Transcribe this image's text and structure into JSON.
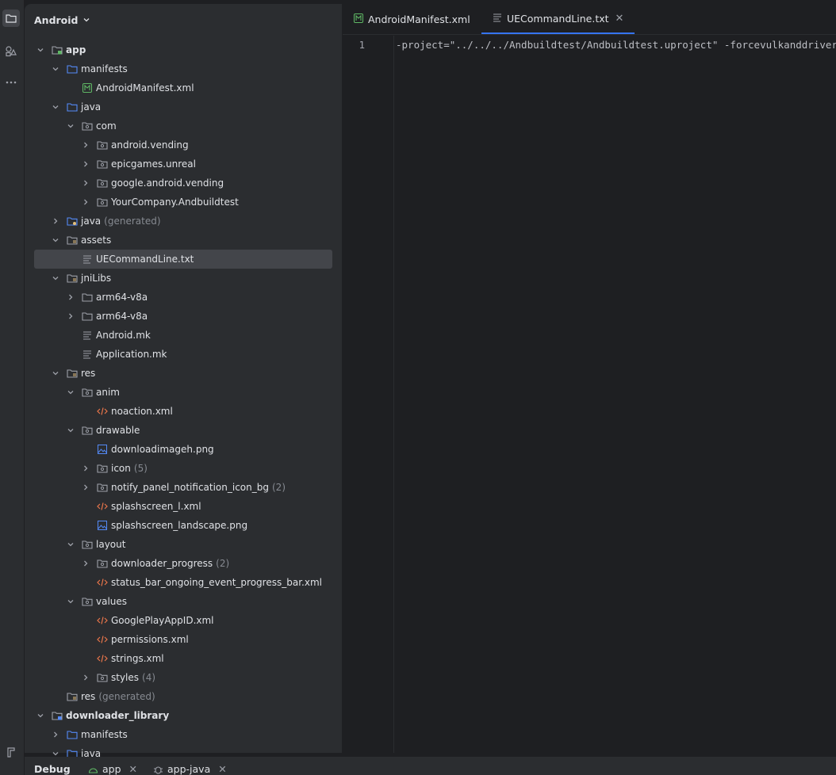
{
  "project_panel": {
    "view_selector": "Android",
    "tree": [
      {
        "label": "app",
        "level": 0,
        "chevron": "down",
        "icon": "module",
        "bold": true
      },
      {
        "label": "manifests",
        "level": 1,
        "chevron": "down",
        "icon": "folder-blue"
      },
      {
        "label": "AndroidManifest.xml",
        "level": 2,
        "chevron": "none",
        "icon": "manifest"
      },
      {
        "label": "java",
        "level": 1,
        "chevron": "down",
        "icon": "folder-blue"
      },
      {
        "label": "com",
        "level": 2,
        "chevron": "down",
        "icon": "package"
      },
      {
        "label": "android.vending",
        "level": 3,
        "chevron": "right",
        "icon": "package"
      },
      {
        "label": "epicgames.unreal",
        "level": 3,
        "chevron": "right",
        "icon": "package"
      },
      {
        "label": "google.android.vending",
        "level": 3,
        "chevron": "right",
        "icon": "package"
      },
      {
        "label": "YourCompany.Andbuildtest",
        "level": 3,
        "chevron": "right",
        "icon": "package"
      },
      {
        "label": "java",
        "level": 1,
        "chevron": "right",
        "icon": "folder-generated",
        "extra": "(generated)"
      },
      {
        "label": "assets",
        "level": 1,
        "chevron": "down",
        "icon": "folder-res"
      },
      {
        "label": "UECommandLine.txt",
        "level": 2,
        "chevron": "none",
        "icon": "text-file",
        "selected": true
      },
      {
        "label": "jniLibs",
        "level": 1,
        "chevron": "down",
        "icon": "folder-res"
      },
      {
        "label": "arm64-v8a",
        "level": 2,
        "chevron": "right",
        "icon": "folder-plain"
      },
      {
        "label": "arm64-v8a",
        "level": 2,
        "chevron": "right",
        "icon": "folder-plain"
      },
      {
        "label": "Android.mk",
        "level": 2,
        "chevron": "none",
        "icon": "text-file"
      },
      {
        "label": "Application.mk",
        "level": 2,
        "chevron": "none",
        "icon": "text-file"
      },
      {
        "label": "res",
        "level": 1,
        "chevron": "down",
        "icon": "folder-res"
      },
      {
        "label": "anim",
        "level": 2,
        "chevron": "down",
        "icon": "package"
      },
      {
        "label": "noaction.xml",
        "level": 3,
        "chevron": "none",
        "icon": "xml-file"
      },
      {
        "label": "drawable",
        "level": 2,
        "chevron": "down",
        "icon": "package"
      },
      {
        "label": "downloadimageh.png",
        "level": 3,
        "chevron": "none",
        "icon": "image-file"
      },
      {
        "label": "icon",
        "level": 3,
        "chevron": "right",
        "icon": "package",
        "extra": "(5)"
      },
      {
        "label": "notify_panel_notification_icon_bg",
        "level": 3,
        "chevron": "right",
        "icon": "package",
        "extra": "(2)"
      },
      {
        "label": "splashscreen_l.xml",
        "level": 3,
        "chevron": "none",
        "icon": "xml-file"
      },
      {
        "label": "splashscreen_landscape.png",
        "level": 3,
        "chevron": "none",
        "icon": "image-file"
      },
      {
        "label": "layout",
        "level": 2,
        "chevron": "down",
        "icon": "package"
      },
      {
        "label": "downloader_progress",
        "level": 3,
        "chevron": "right",
        "icon": "package",
        "extra": "(2)"
      },
      {
        "label": "status_bar_ongoing_event_progress_bar.xml",
        "level": 3,
        "chevron": "none",
        "icon": "xml-file"
      },
      {
        "label": "values",
        "level": 2,
        "chevron": "down",
        "icon": "package"
      },
      {
        "label": "GooglePlayAppID.xml",
        "level": 3,
        "chevron": "none",
        "icon": "xml-file"
      },
      {
        "label": "permissions.xml",
        "level": 3,
        "chevron": "none",
        "icon": "xml-file"
      },
      {
        "label": "strings.xml",
        "level": 3,
        "chevron": "none",
        "icon": "xml-file"
      },
      {
        "label": "styles",
        "level": 3,
        "chevron": "right",
        "icon": "package",
        "extra": "(4)"
      },
      {
        "label": "res",
        "level": 1,
        "chevron": "none",
        "icon": "folder-res",
        "extra": "(generated)"
      },
      {
        "label": "downloader_library",
        "level": 0,
        "chevron": "down",
        "icon": "module-lib",
        "bold": true
      },
      {
        "label": "manifests",
        "level": 1,
        "chevron": "right",
        "icon": "folder-blue"
      },
      {
        "label": "java",
        "level": 1,
        "chevron": "down",
        "icon": "folder-blue"
      }
    ]
  },
  "editor": {
    "tabs": [
      {
        "label": "AndroidManifest.xml",
        "icon": "manifest",
        "active": false
      },
      {
        "label": "UECommandLine.txt",
        "icon": "text-file",
        "active": true,
        "close": "✕"
      }
    ],
    "line_number": "1",
    "line_text": "-project=\"../../../Andbuildtest/Andbuildtest.uproject\" -forcevulkanddrivers"
  },
  "bottom_bar": {
    "tabs": [
      {
        "label": "Debug",
        "bold": true
      },
      {
        "label": "app",
        "close": "✕"
      },
      {
        "label": "app-java",
        "close": "✕"
      }
    ]
  },
  "colors": {
    "accent": "#3574f0",
    "folder": "#548af7",
    "xml": "#e8754a",
    "manifest": "#5fb865",
    "panel": "#2b2d30",
    "editor_bg": "#1e1f22"
  }
}
